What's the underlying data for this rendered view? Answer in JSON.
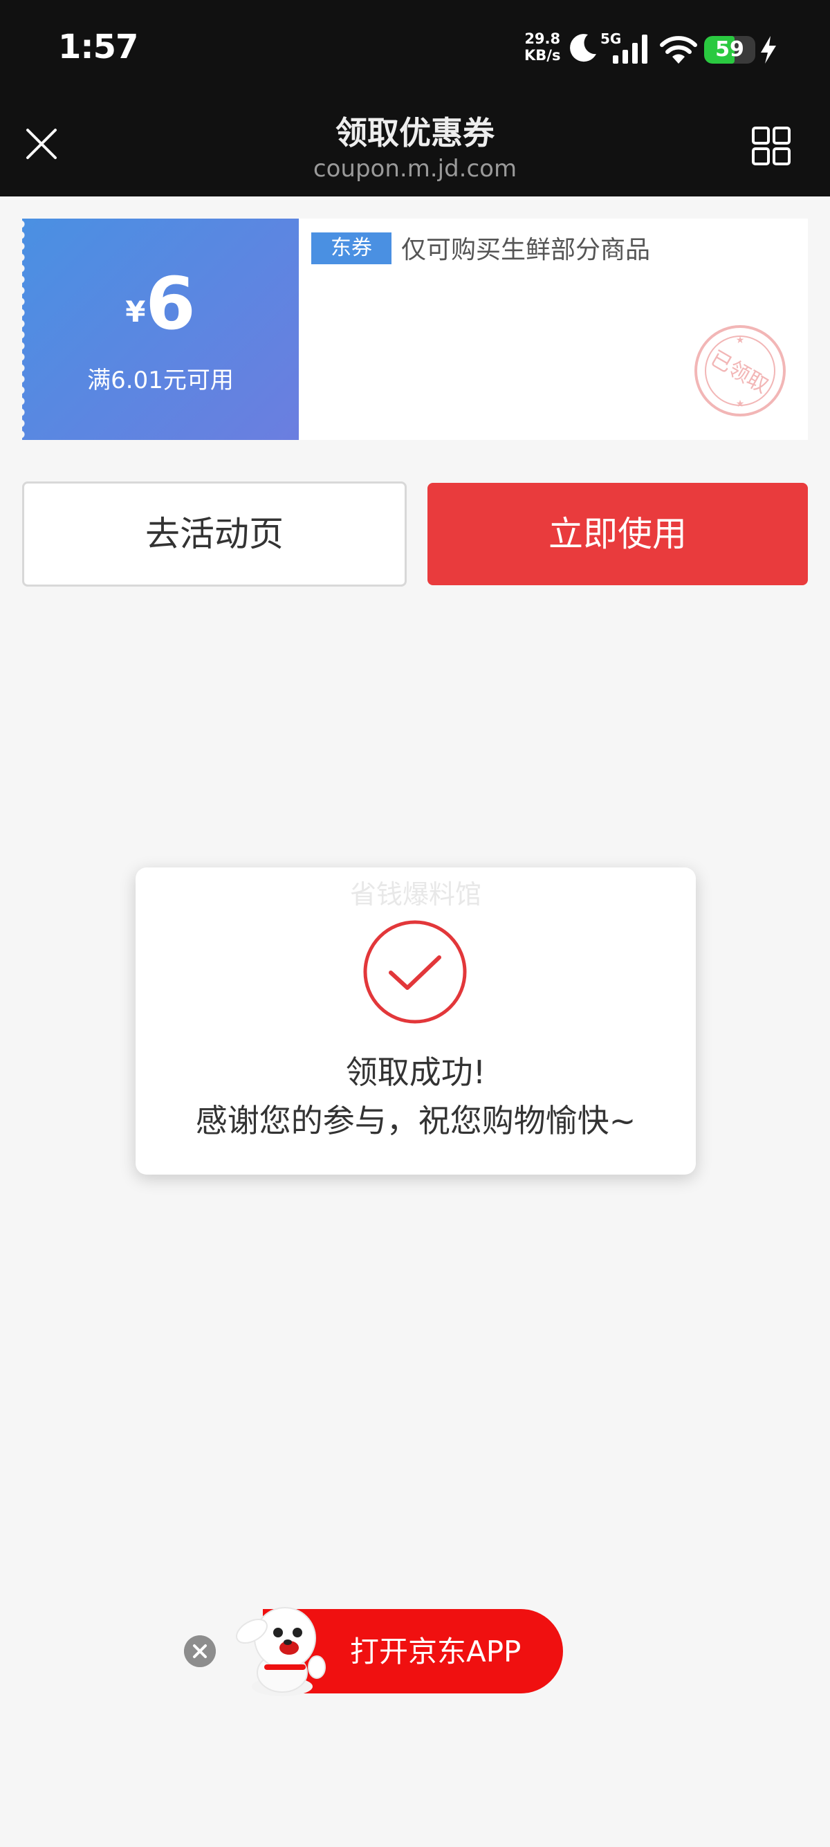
{
  "status_bar": {
    "time": "1:57",
    "net_speed_value": "29.8",
    "net_speed_unit": "KB/s",
    "network": "5G",
    "battery": "59",
    "battery_level": 0.59,
    "icons": [
      "moon-icon",
      "signal-icon",
      "wifi-icon",
      "battery-icon",
      "charging-icon"
    ]
  },
  "title_bar": {
    "title": "领取优惠券",
    "url": "coupon.m.jd.com",
    "close_icon": "close-icon",
    "menu_icon": "grid-icon"
  },
  "coupon": {
    "currency": "¥",
    "amount": "6",
    "condition": "满6.01元可用",
    "tag": "东券",
    "description": "仅可购买生鲜部分商品",
    "stamp_text": "已领取",
    "colors": {
      "gradient_start": "#4a90e2",
      "gradient_end": "#6b7ee0",
      "stamp": "#f2b6b6"
    }
  },
  "actions": {
    "activity_label": "去活动页",
    "use_label": "立即使用",
    "use_color": "#e93b3d"
  },
  "dialog": {
    "watermark": "省钱爆料馆",
    "title": "领取成功!",
    "message": "感谢您的参与，祝您购物愉快~",
    "check_color": "#e2373a"
  },
  "app_banner": {
    "label": "打开京东APP",
    "color": "#f01010"
  }
}
